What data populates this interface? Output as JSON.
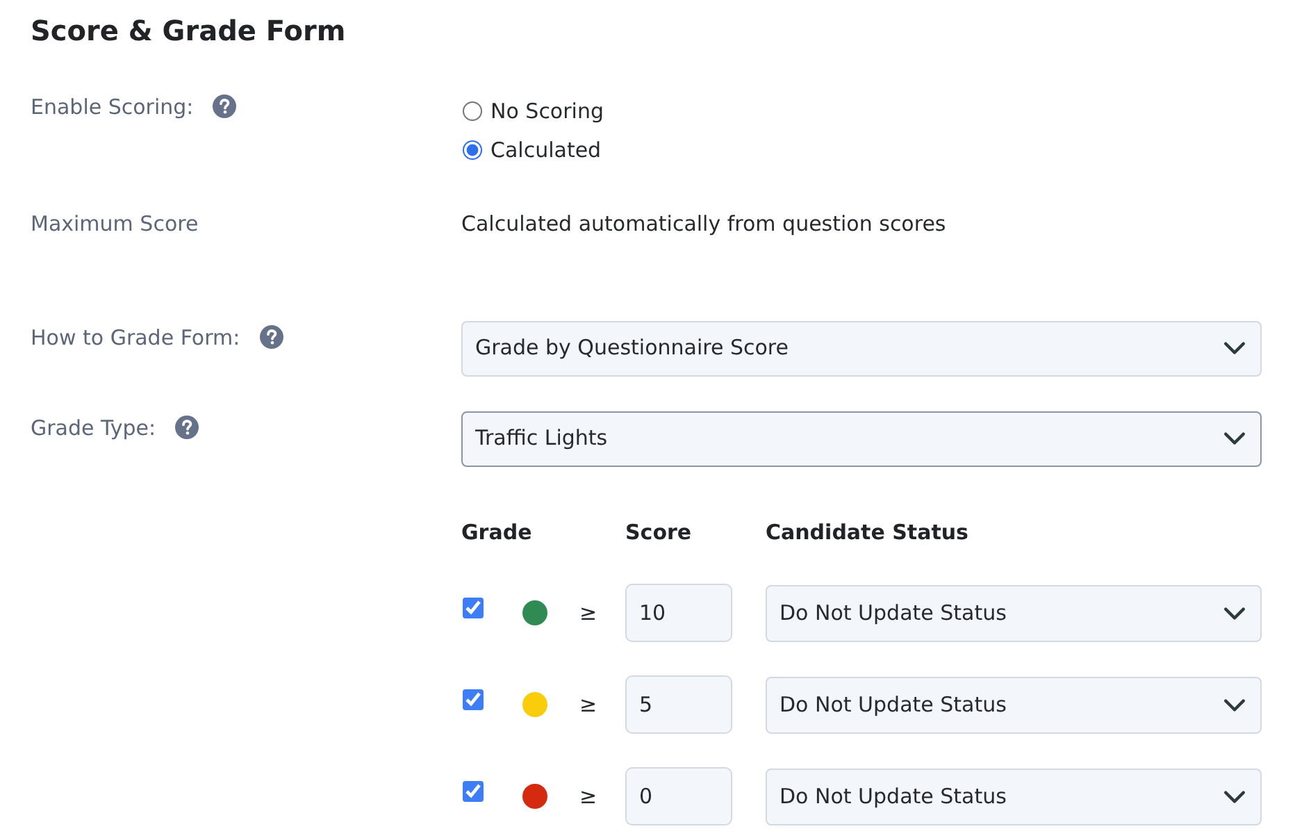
{
  "title": "Score & Grade Form",
  "fields": [
    {
      "kind": "radio",
      "label": "Enable Scoring:",
      "help": true,
      "options": [
        {
          "label": "No Scoring",
          "selected": false
        },
        {
          "label": "Calculated",
          "selected": true
        }
      ]
    },
    {
      "kind": "text",
      "label": "Maximum Score",
      "help": false,
      "value": "Calculated automatically from question scores"
    },
    {
      "kind": "select",
      "label": "How to Grade Form:",
      "help": true,
      "value": "Grade by Questionnaire Score",
      "focused": false
    },
    {
      "kind": "select",
      "label": "Grade Type:",
      "help": true,
      "value": "Traffic Lights",
      "focused": true
    }
  ],
  "grades": {
    "columns": [
      "Grade",
      "Score",
      "Candidate Status"
    ],
    "rows": [
      {
        "checked": true,
        "color": "#2f8a53",
        "operator": "≥",
        "score": "10",
        "status": "Do Not Update Status"
      },
      {
        "checked": true,
        "color": "#f9cc0c",
        "operator": "≥",
        "score": "5",
        "status": "Do Not Update Status"
      },
      {
        "checked": true,
        "color": "#d42a0f",
        "operator": "≥",
        "score": "0",
        "status": "Do Not Update Status"
      }
    ]
  }
}
